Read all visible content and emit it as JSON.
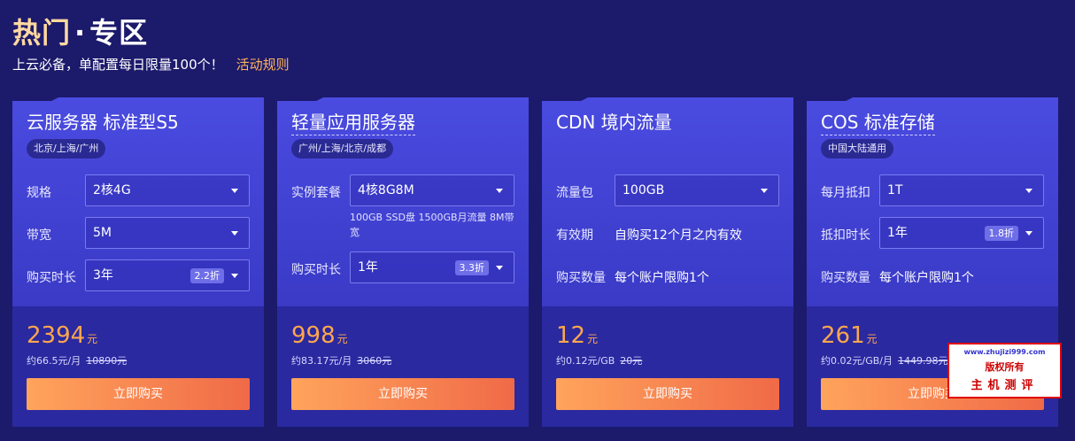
{
  "header": {
    "title_a": "热门",
    "title_dot": "·",
    "title_b": "专区",
    "subtitle": "上云必备，单配置每日限量100个！",
    "rules_link": "活动规则"
  },
  "cards": [
    {
      "title": "云服务器 标准型S5",
      "region": "北京/上海/广州",
      "rows": [
        {
          "label": "规格",
          "value": "2核4G"
        },
        {
          "label": "带宽",
          "value": "5M"
        },
        {
          "label": "购买时长",
          "value": "3年",
          "discount": "2.2折"
        }
      ],
      "price": "2394",
      "price_unit": "元",
      "per_month": "约66.5元/月",
      "original": "10890元",
      "buy": "立即购买"
    },
    {
      "title": "轻量应用服务器",
      "region": "广州/上海/北京/成都",
      "rows": [
        {
          "label": "实例套餐",
          "value": "4核8G8M",
          "note": "100GB SSD盘 1500GB月流量 8M带宽"
        },
        {
          "label": "购买时长",
          "value": "1年",
          "discount": "3.3折"
        }
      ],
      "price": "998",
      "price_unit": "元",
      "per_month": "约83.17元/月",
      "original": "3060元",
      "buy": "立即购买"
    },
    {
      "title": "CDN 境内流量",
      "rows": [
        {
          "label": "流量包",
          "value": "100GB"
        },
        {
          "label": "有效期",
          "text": "自购买12个月之内有效"
        },
        {
          "label": "购买数量",
          "text": "每个账户限购1个"
        }
      ],
      "price": "12",
      "price_unit": "元",
      "per_month": "约0.12元/GB",
      "original": "20元",
      "buy": "立即购买"
    },
    {
      "title": "COS 标准存储",
      "region": "中国大陆通用",
      "rows": [
        {
          "label": "每月抵扣",
          "value": "1T"
        },
        {
          "label": "抵扣时长",
          "value": "1年",
          "discount": "1.8折"
        },
        {
          "label": "购买数量",
          "text": "每个账户限购1个"
        }
      ],
      "price": "261",
      "price_unit": "元",
      "per_month": "约0.02元/GB/月",
      "original": "1449.98元",
      "buy": "立即购买"
    }
  ],
  "watermark": {
    "line1": "www.zhujizi999.com",
    "line2": "版权所有",
    "line3": "主机测评"
  },
  "colors": {
    "background": "#1c1a6b",
    "card": "#4a4be0",
    "price": "#ffa64d",
    "button_start": "#ffa45c",
    "button_end": "#f06a47",
    "title_accent": "#ffd9a0",
    "link": "#ffb45a"
  }
}
